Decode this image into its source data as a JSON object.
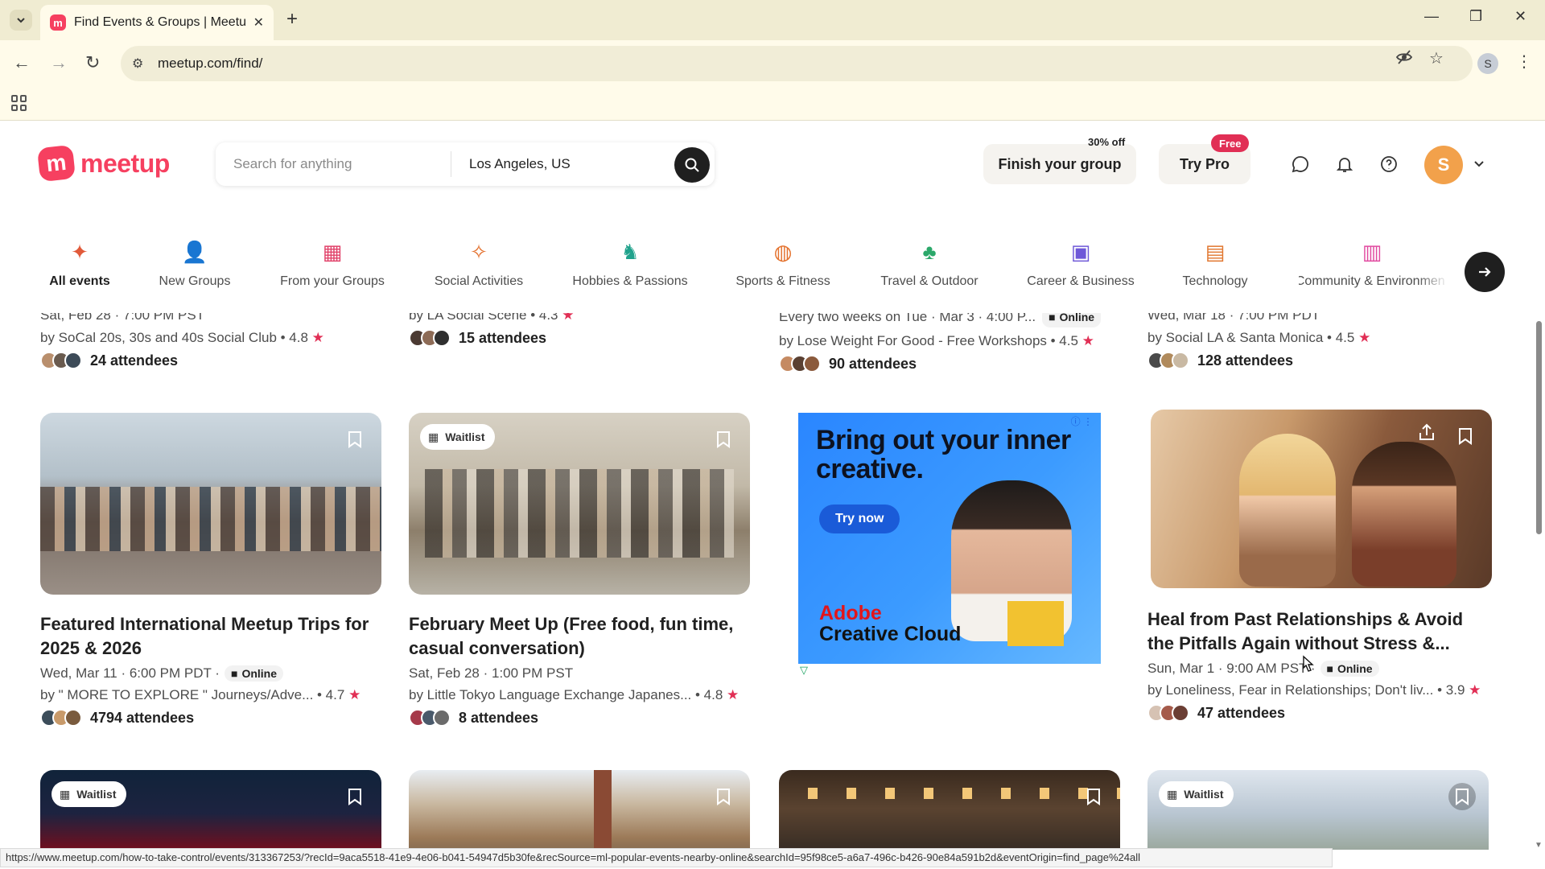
{
  "browser": {
    "tab_title": "Find Events & Groups | Meetup",
    "favicon_letter": "m",
    "url": "meetup.com/find/",
    "profile_initial": "S",
    "status_url": "https://www.meetup.com/how-to-take-control/events/313367253/?recId=9aca5518-41e9-4e06-b041-54947d5b30fe&recSource=ml-popular-events-nearby-online&searchId=95f98ce5-a6a7-496c-b426-90e84a591b2d&eventOrigin=find_page%24all"
  },
  "header": {
    "logo_text": "meetup",
    "logo_letter": "m",
    "search_placeholder": "Search for anything",
    "location_value": "Los Angeles, US",
    "finish_group_label": "Finish your group",
    "finish_group_badge": "30% off",
    "try_pro_label": "Try Pro",
    "try_pro_badge": "Free",
    "avatar_initial": "S"
  },
  "categories": [
    {
      "label": "All events",
      "icon": "sparkle-icon",
      "active": true
    },
    {
      "label": "New Groups",
      "icon": "person-icon"
    },
    {
      "label": "From your Groups",
      "icon": "calendar-icon"
    },
    {
      "label": "Social Activities",
      "icon": "party-icon"
    },
    {
      "label": "Hobbies & Passions",
      "icon": "dice-icon"
    },
    {
      "label": "Sports & Fitness",
      "icon": "ball-icon"
    },
    {
      "label": "Travel & Outdoor",
      "icon": "tree-icon"
    },
    {
      "label": "Career & Business",
      "icon": "briefcase-icon"
    },
    {
      "label": "Technology",
      "icon": "laptop-icon"
    },
    {
      "label": "Community & Environment",
      "icon": "building-icon"
    }
  ],
  "top_row": [
    {
      "date": "Sat, Feb 28 · 7:00 PM PST",
      "by": "by SoCal 20s, 30s and 40s Social Club • 4.8",
      "attendees": "24 attendees"
    },
    {
      "date": "by LA Social Scene • 4.3",
      "by": "",
      "attendees": "15 attendees"
    },
    {
      "date": "Every two weeks on Tue · Mar 3 · 4:00 P...",
      "online": "Online",
      "by": "by Lose Weight For Good - Free Workshops • 4.5",
      "attendees": "90 attendees"
    },
    {
      "date": "Wed, Mar 18 · 7:00 PM PDT",
      "by": "by Social LA & Santa Monica • 4.5",
      "attendees": "128 attendees"
    }
  ],
  "events": [
    {
      "title": "Featured International Meetup Trips for 2025 & 2026",
      "date": "Wed, Mar 11 · 6:00 PM PDT ·",
      "online": "Online",
      "by": "by \" MORE TO EXPLORE \" Journeys/Adve... • 4.7",
      "attendees": "4794 attendees"
    },
    {
      "badge": "Waitlist",
      "title": "February Meet Up (Free food, fun time, casual conversation)",
      "date": "Sat, Feb 28 · 1:00 PM PST",
      "by": "by Little Tokyo Language Exchange Japanes... • 4.8",
      "attendees": "8 attendees"
    },
    {
      "title": "Heal from Past Relationships & Avoid the Pitfalls Again without Stress &...",
      "date": "Sun, Mar 1 · 9:00 AM PST ·",
      "online": "Online",
      "by": "by Loneliness, Fear in Relationships; Don't liv... • 3.9",
      "attendees": "47 attendees"
    }
  ],
  "ad": {
    "headline": "Bring out your inner creative.",
    "cta": "Try now",
    "brand_line1": "Adobe",
    "brand_line2": "Creative Cloud"
  },
  "bottom_row": [
    {
      "badge": "Waitlist"
    },
    {},
    {},
    {
      "badge": "Waitlist"
    }
  ],
  "colors": {
    "brand": "#f64060",
    "star": "#e12f55",
    "pro_badge": "#e12f55"
  }
}
